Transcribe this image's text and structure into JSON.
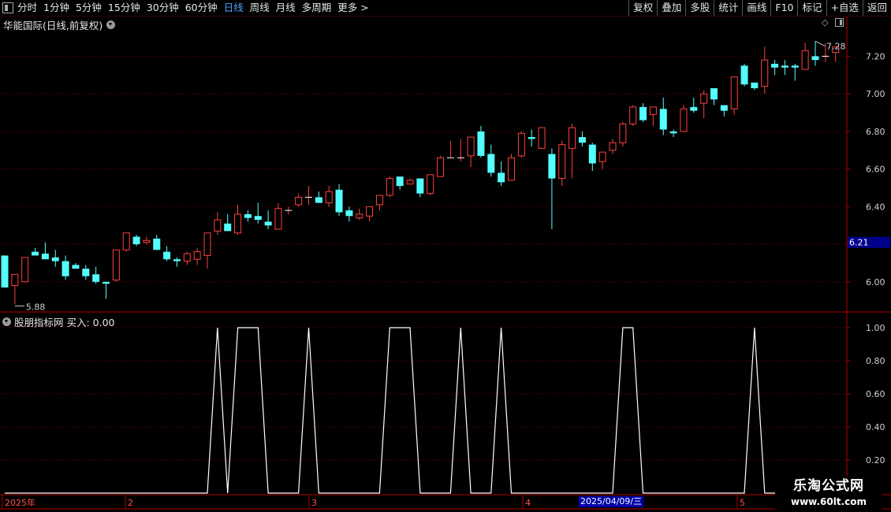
{
  "toolbar": {
    "periods": [
      "分时",
      "1分钟",
      "5分钟",
      "15分钟",
      "30分钟",
      "60分钟",
      "日线",
      "周线",
      "月线",
      "多周期",
      "更多 >"
    ],
    "active_period": "日线",
    "actions": [
      "复权",
      "叠加",
      "多股",
      "统计",
      "画线",
      "F10",
      "标记",
      "+自选",
      "返回"
    ]
  },
  "main_chart": {
    "title": "华能国际(日线,前复权)",
    "y_ticks": [
      "7.20",
      "7.00",
      "6.80",
      "6.60",
      "6.40",
      "6.20",
      "6.00"
    ],
    "current_price": "6.21",
    "max_label": "7.28",
    "min_label": "5.88",
    "colors": {
      "up": "#ff4040",
      "down": "#54ffff",
      "grid": "#7a0000",
      "axis": "#b00000",
      "price_tag_bg": "#00008b"
    }
  },
  "sub_chart": {
    "title": "股朋指标网  买入: 0.00",
    "y_ticks": [
      "1.00",
      "0.80",
      "0.60",
      "0.40",
      "0.20"
    ],
    "line_color": "#ffffff"
  },
  "time_axis": {
    "labels": [
      "2025年",
      "2",
      "3",
      "4",
      "5"
    ],
    "cursor_date": "2025/04/09/三"
  },
  "watermark": {
    "line1": "乐淘公式网",
    "line2": "www.60lt.com"
  },
  "chart_data": {
    "type": "candlestick",
    "ylim": [
      5.84,
      7.34
    ],
    "candles": [
      [
        6.14,
        6.14,
        5.97,
        5.97
      ],
      [
        5.98,
        6.0,
        5.88,
        6.04
      ],
      [
        6.0,
        6.13,
        6.0,
        6.13
      ],
      [
        6.16,
        6.18,
        6.15,
        6.14
      ],
      [
        6.15,
        6.21,
        6.12,
        6.12
      ],
      [
        6.13,
        6.17,
        6.08,
        6.11
      ],
      [
        6.11,
        6.14,
        6.01,
        6.03
      ],
      [
        6.09,
        6.1,
        6.07,
        6.07
      ],
      [
        6.07,
        6.09,
        6.01,
        6.03
      ],
      [
        6.04,
        6.08,
        5.99,
        6.0
      ],
      [
        6.0,
        6.0,
        5.91,
        5.99
      ],
      [
        6.01,
        6.17,
        6.0,
        6.17
      ],
      [
        6.17,
        6.26,
        6.16,
        6.26
      ],
      [
        6.24,
        6.25,
        6.19,
        6.2
      ],
      [
        6.21,
        6.24,
        6.2,
        6.22
      ],
      [
        6.23,
        6.25,
        6.17,
        6.17
      ],
      [
        6.16,
        6.19,
        6.11,
        6.12
      ],
      [
        6.12,
        6.13,
        6.08,
        6.11
      ],
      [
        6.11,
        6.16,
        6.09,
        6.15
      ],
      [
        6.12,
        6.18,
        6.09,
        6.16
      ],
      [
        6.14,
        6.26,
        6.07,
        6.26
      ],
      [
        6.27,
        6.37,
        6.25,
        6.33
      ],
      [
        6.31,
        6.36,
        6.27,
        6.27
      ],
      [
        6.26,
        6.41,
        6.25,
        6.36
      ],
      [
        6.36,
        6.38,
        6.32,
        6.34
      ],
      [
        6.35,
        6.42,
        6.31,
        6.33
      ],
      [
        6.32,
        6.38,
        6.28,
        6.3
      ],
      [
        6.28,
        6.42,
        6.28,
        6.39
      ],
      [
        6.38,
        6.4,
        6.36,
        6.38
      ],
      [
        6.41,
        6.47,
        6.4,
        6.45
      ],
      [
        6.45,
        6.51,
        6.41,
        6.45
      ],
      [
        6.45,
        6.48,
        6.43,
        6.42
      ],
      [
        6.42,
        6.51,
        6.4,
        6.48
      ],
      [
        6.49,
        6.52,
        6.35,
        6.37
      ],
      [
        6.38,
        6.4,
        6.32,
        6.35
      ],
      [
        6.34,
        6.39,
        6.33,
        6.36
      ],
      [
        6.35,
        6.4,
        6.32,
        6.4
      ],
      [
        6.41,
        6.44,
        6.38,
        6.46
      ],
      [
        6.46,
        6.56,
        6.45,
        6.55
      ],
      [
        6.56,
        6.56,
        6.49,
        6.51
      ],
      [
        6.52,
        6.55,
        6.52,
        6.54
      ],
      [
        6.55,
        6.55,
        6.45,
        6.47
      ],
      [
        6.47,
        6.57,
        6.46,
        6.57
      ],
      [
        6.56,
        6.67,
        6.56,
        6.66
      ],
      [
        6.66,
        6.75,
        6.66,
        6.66
      ],
      [
        6.66,
        6.76,
        6.64,
        6.66
      ],
      [
        6.67,
        6.76,
        6.61,
        6.77
      ],
      [
        6.8,
        6.83,
        6.66,
        6.67
      ],
      [
        6.68,
        6.73,
        6.56,
        6.58
      ],
      [
        6.58,
        6.64,
        6.51,
        6.53
      ],
      [
        6.54,
        6.68,
        6.54,
        6.66
      ],
      [
        6.67,
        6.8,
        6.66,
        6.79
      ],
      [
        6.77,
        6.81,
        6.72,
        6.76
      ],
      [
        6.71,
        6.79,
        6.71,
        6.82
      ],
      [
        6.68,
        6.71,
        6.28,
        6.55
      ],
      [
        6.55,
        6.75,
        6.51,
        6.73
      ],
      [
        6.71,
        6.84,
        6.55,
        6.82
      ],
      [
        6.77,
        6.8,
        6.72,
        6.74
      ],
      [
        6.73,
        6.74,
        6.59,
        6.63
      ],
      [
        6.64,
        6.69,
        6.6,
        6.69
      ],
      [
        6.7,
        6.76,
        6.68,
        6.74
      ],
      [
        6.74,
        6.85,
        6.72,
        6.84
      ],
      [
        6.84,
        6.94,
        6.83,
        6.93
      ],
      [
        6.93,
        6.95,
        6.85,
        6.86
      ],
      [
        6.89,
        6.93,
        6.83,
        6.93
      ],
      [
        6.92,
        6.98,
        6.78,
        6.81
      ],
      [
        6.8,
        6.81,
        6.77,
        6.79
      ],
      [
        6.8,
        6.94,
        6.8,
        6.92
      ],
      [
        6.93,
        6.98,
        6.9,
        6.91
      ],
      [
        6.95,
        7.02,
        6.87,
        7.0
      ],
      [
        7.03,
        7.03,
        6.94,
        6.97
      ],
      [
        6.94,
        6.93,
        6.88,
        6.91
      ],
      [
        6.92,
        7.09,
        6.89,
        7.09
      ],
      [
        7.15,
        7.16,
        7.04,
        7.05
      ],
      [
        7.06,
        7.05,
        7.02,
        7.03
      ],
      [
        7.04,
        7.25,
        7.0,
        7.18
      ],
      [
        7.16,
        7.18,
        7.1,
        7.14
      ],
      [
        7.15,
        7.18,
        7.1,
        7.14
      ],
      [
        7.15,
        7.16,
        7.07,
        7.14
      ],
      [
        7.13,
        7.27,
        7.13,
        7.23
      ],
      [
        7.2,
        7.28,
        7.15,
        7.18
      ],
      [
        7.2,
        7.27,
        7.17,
        7.2
      ],
      [
        7.22,
        7.25,
        7.17,
        7.25
      ]
    ],
    "indicator": [
      0,
      0,
      0,
      0,
      0,
      0,
      0,
      0,
      0,
      0,
      0,
      0,
      0,
      0,
      0,
      0,
      0,
      0,
      0,
      0,
      0,
      1,
      0,
      1,
      1,
      1,
      0,
      0,
      0,
      0,
      1,
      0,
      0,
      0,
      0,
      0,
      0,
      0,
      1,
      1,
      1,
      0,
      0,
      0,
      0,
      1,
      0,
      0,
      0,
      1,
      0,
      0,
      0,
      0,
      0,
      0,
      0,
      0,
      0,
      0,
      0,
      1,
      1,
      0,
      0,
      0,
      0,
      0,
      0,
      0,
      0,
      0,
      0,
      0,
      1,
      0,
      0,
      0,
      0,
      0,
      0,
      0,
      0
    ]
  }
}
